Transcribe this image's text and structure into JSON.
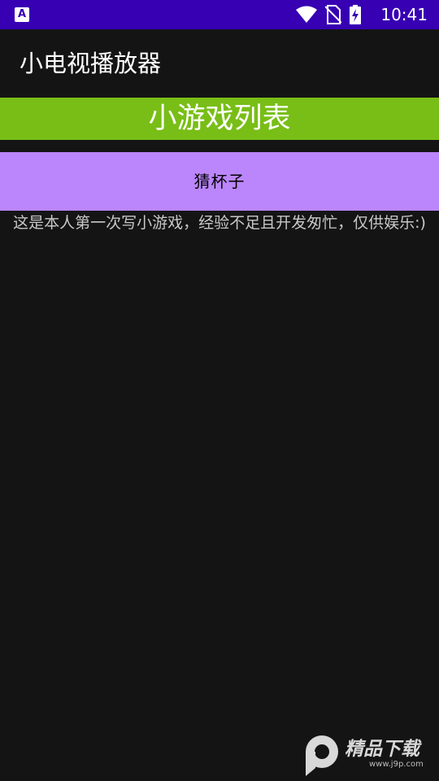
{
  "status_bar": {
    "time": "10:41",
    "left_icon_label": "A",
    "icons": [
      "wifi-icon",
      "no-sim-icon",
      "battery-charging-icon"
    ],
    "background": "#3700b3"
  },
  "app_bar": {
    "title": "小电视播放器"
  },
  "game_list": {
    "header": "小游戏列表",
    "header_color": "#78be16",
    "items": [
      {
        "label": "猜杯子",
        "color": "#bb86fc"
      }
    ]
  },
  "description": "这是本人第一次写小游戏，经验不足且开发匆忙，仅供娱乐:)",
  "watermark": {
    "title": "精品下载",
    "url": "www.j9p.com"
  }
}
